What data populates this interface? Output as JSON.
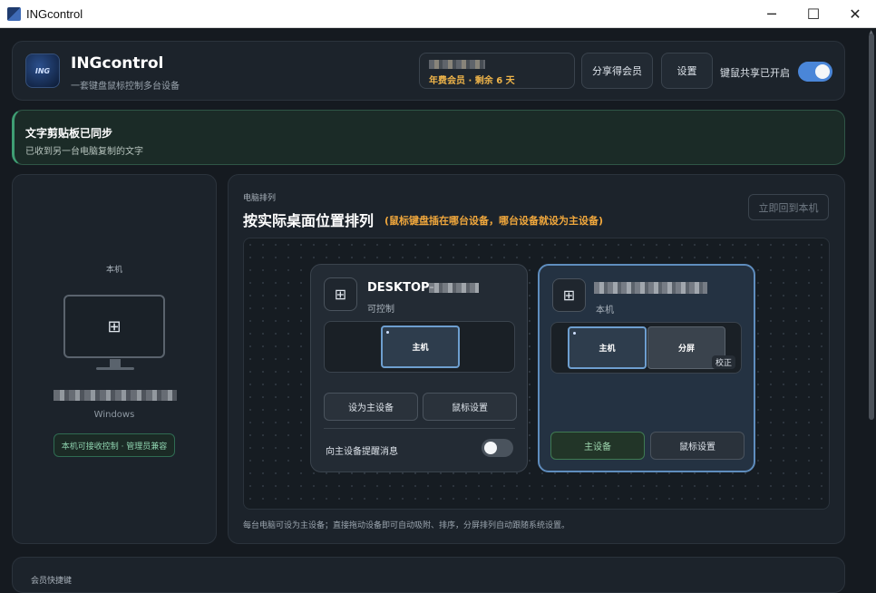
{
  "window": {
    "title": "INGcontrol",
    "minimize": "─",
    "maximize": "☐",
    "close": "✕"
  },
  "header": {
    "logo_text": "ING",
    "app_name": "INGcontrol",
    "subtitle": "一套键盘鼠标控制多台设备",
    "membership": "年费会员 · 剩余 6 天",
    "share_label": "分享得会员",
    "settings_label": "设置",
    "kvm_label": "键鼠共享已开启",
    "kvm_enabled": true
  },
  "banner": {
    "title": "文字剪贴板已同步",
    "message": "已收到另一台电脑复制的文字"
  },
  "local": {
    "label": "本机",
    "os": "Windows",
    "status_pill": "本机可接收控制 · 管理员兼容",
    "icon": "window-grid-icon"
  },
  "layout": {
    "eyebrow": "电脑排列",
    "title": "按实际桌面位置排列",
    "hint": "(鼠标键盘插在哪台设备，哪台设备就设为主设备)",
    "back_button": "立即回到本机",
    "footnote": "每台电脑可设为主设备；直接拖动设备即可自动吸附、排序，分屏排列自动跟随系统设置。",
    "devices": [
      {
        "name_prefix": "DESKTOP-",
        "status": "可控制",
        "screens": [
          "主机"
        ],
        "set_main_label": "设为主设备",
        "mouse_label": "鼠标设置",
        "remind_label": "向主设备提醒消息",
        "remind_enabled": false
      },
      {
        "status": "本机",
        "screens": [
          "主机",
          "分屏"
        ],
        "calibrate_label": "校正",
        "main_label": "主设备",
        "mouse_label": "鼠标设置"
      }
    ]
  },
  "bottom": {
    "title": "会员快捷键"
  },
  "colors": {
    "accent": "#4a86d8",
    "warning": "#f0a73c",
    "success": "#3f9e73",
    "membership": "#f0b54a"
  }
}
